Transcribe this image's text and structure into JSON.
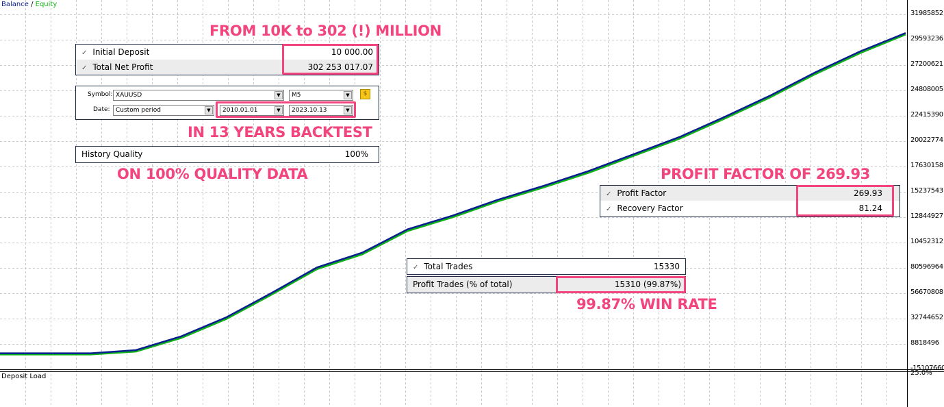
{
  "legend": {
    "balance": "Balance",
    "sep": " / ",
    "equity": "Equity"
  },
  "colors": {
    "balance": "#0a1f8f",
    "equity": "#13b21a",
    "accent": "#f2457e"
  },
  "annotations": {
    "growth": "FROM 10K to 302 (!) MILLION",
    "period": "IN 13 YEARS BACKTEST",
    "quality": "ON 100% QUALITY DATA",
    "profit_factor": "PROFIT FACTOR OF 269.93",
    "win_rate": "99.87% WIN RATE"
  },
  "deposit_box": {
    "rows": [
      {
        "label": "Initial Deposit",
        "value": "10 000.00"
      },
      {
        "label": "Total Net Profit",
        "value": "302 253 017.07"
      }
    ]
  },
  "settings": {
    "symbol_label": "Symbol:",
    "symbol": "XAUUSD",
    "timeframe": "M5",
    "date_label": "Date:",
    "period": "Custom period",
    "from": "2010.01.01",
    "to": "2023.10.13",
    "button_icon": "dollar-icon"
  },
  "quality_box": {
    "label": "History Quality",
    "value": "100%"
  },
  "factor_box": {
    "rows": [
      {
        "label": "Profit Factor",
        "value": "269.93"
      },
      {
        "label": "Recovery Factor",
        "value": "81.24"
      }
    ]
  },
  "trades_box": {
    "total_label": "Total Trades",
    "total_value": "15330",
    "profit_label": "Profit Trades (% of total)",
    "profit_value": "15310 (99.87%)"
  },
  "deposit_load": {
    "title": "Deposit Load",
    "axis_label": "25.0%"
  },
  "chart_data": {
    "type": "line",
    "y_tick_labels": [
      "31985852",
      "29593236",
      "27200621",
      "24808005",
      "22415390",
      "20022774",
      "17630158",
      "15237543",
      "12844927",
      "10452312",
      "80596964",
      "56670808",
      "32744652",
      "8818496",
      "-15107660"
    ],
    "grid": true,
    "series": [
      {
        "name": "Balance",
        "values": [
          10000,
          10000,
          10000,
          3000000,
          16000000,
          34000000,
          57000000,
          81000000,
          95000000,
          117000000,
          130000000,
          145000000,
          158000000,
          172000000,
          188000000,
          204000000,
          223000000,
          243000000,
          265000000,
          285000000,
          302263017
        ]
      },
      {
        "name": "Equity",
        "values": [
          10000,
          10000,
          10000,
          2700000,
          15500000,
          33500000,
          56500000,
          80500000,
          94500000,
          116500000,
          129500000,
          144500000,
          157500000,
          171500000,
          187500000,
          203500000,
          222500000,
          242500000,
          264500000,
          284500000,
          302000000
        ]
      }
    ]
  }
}
